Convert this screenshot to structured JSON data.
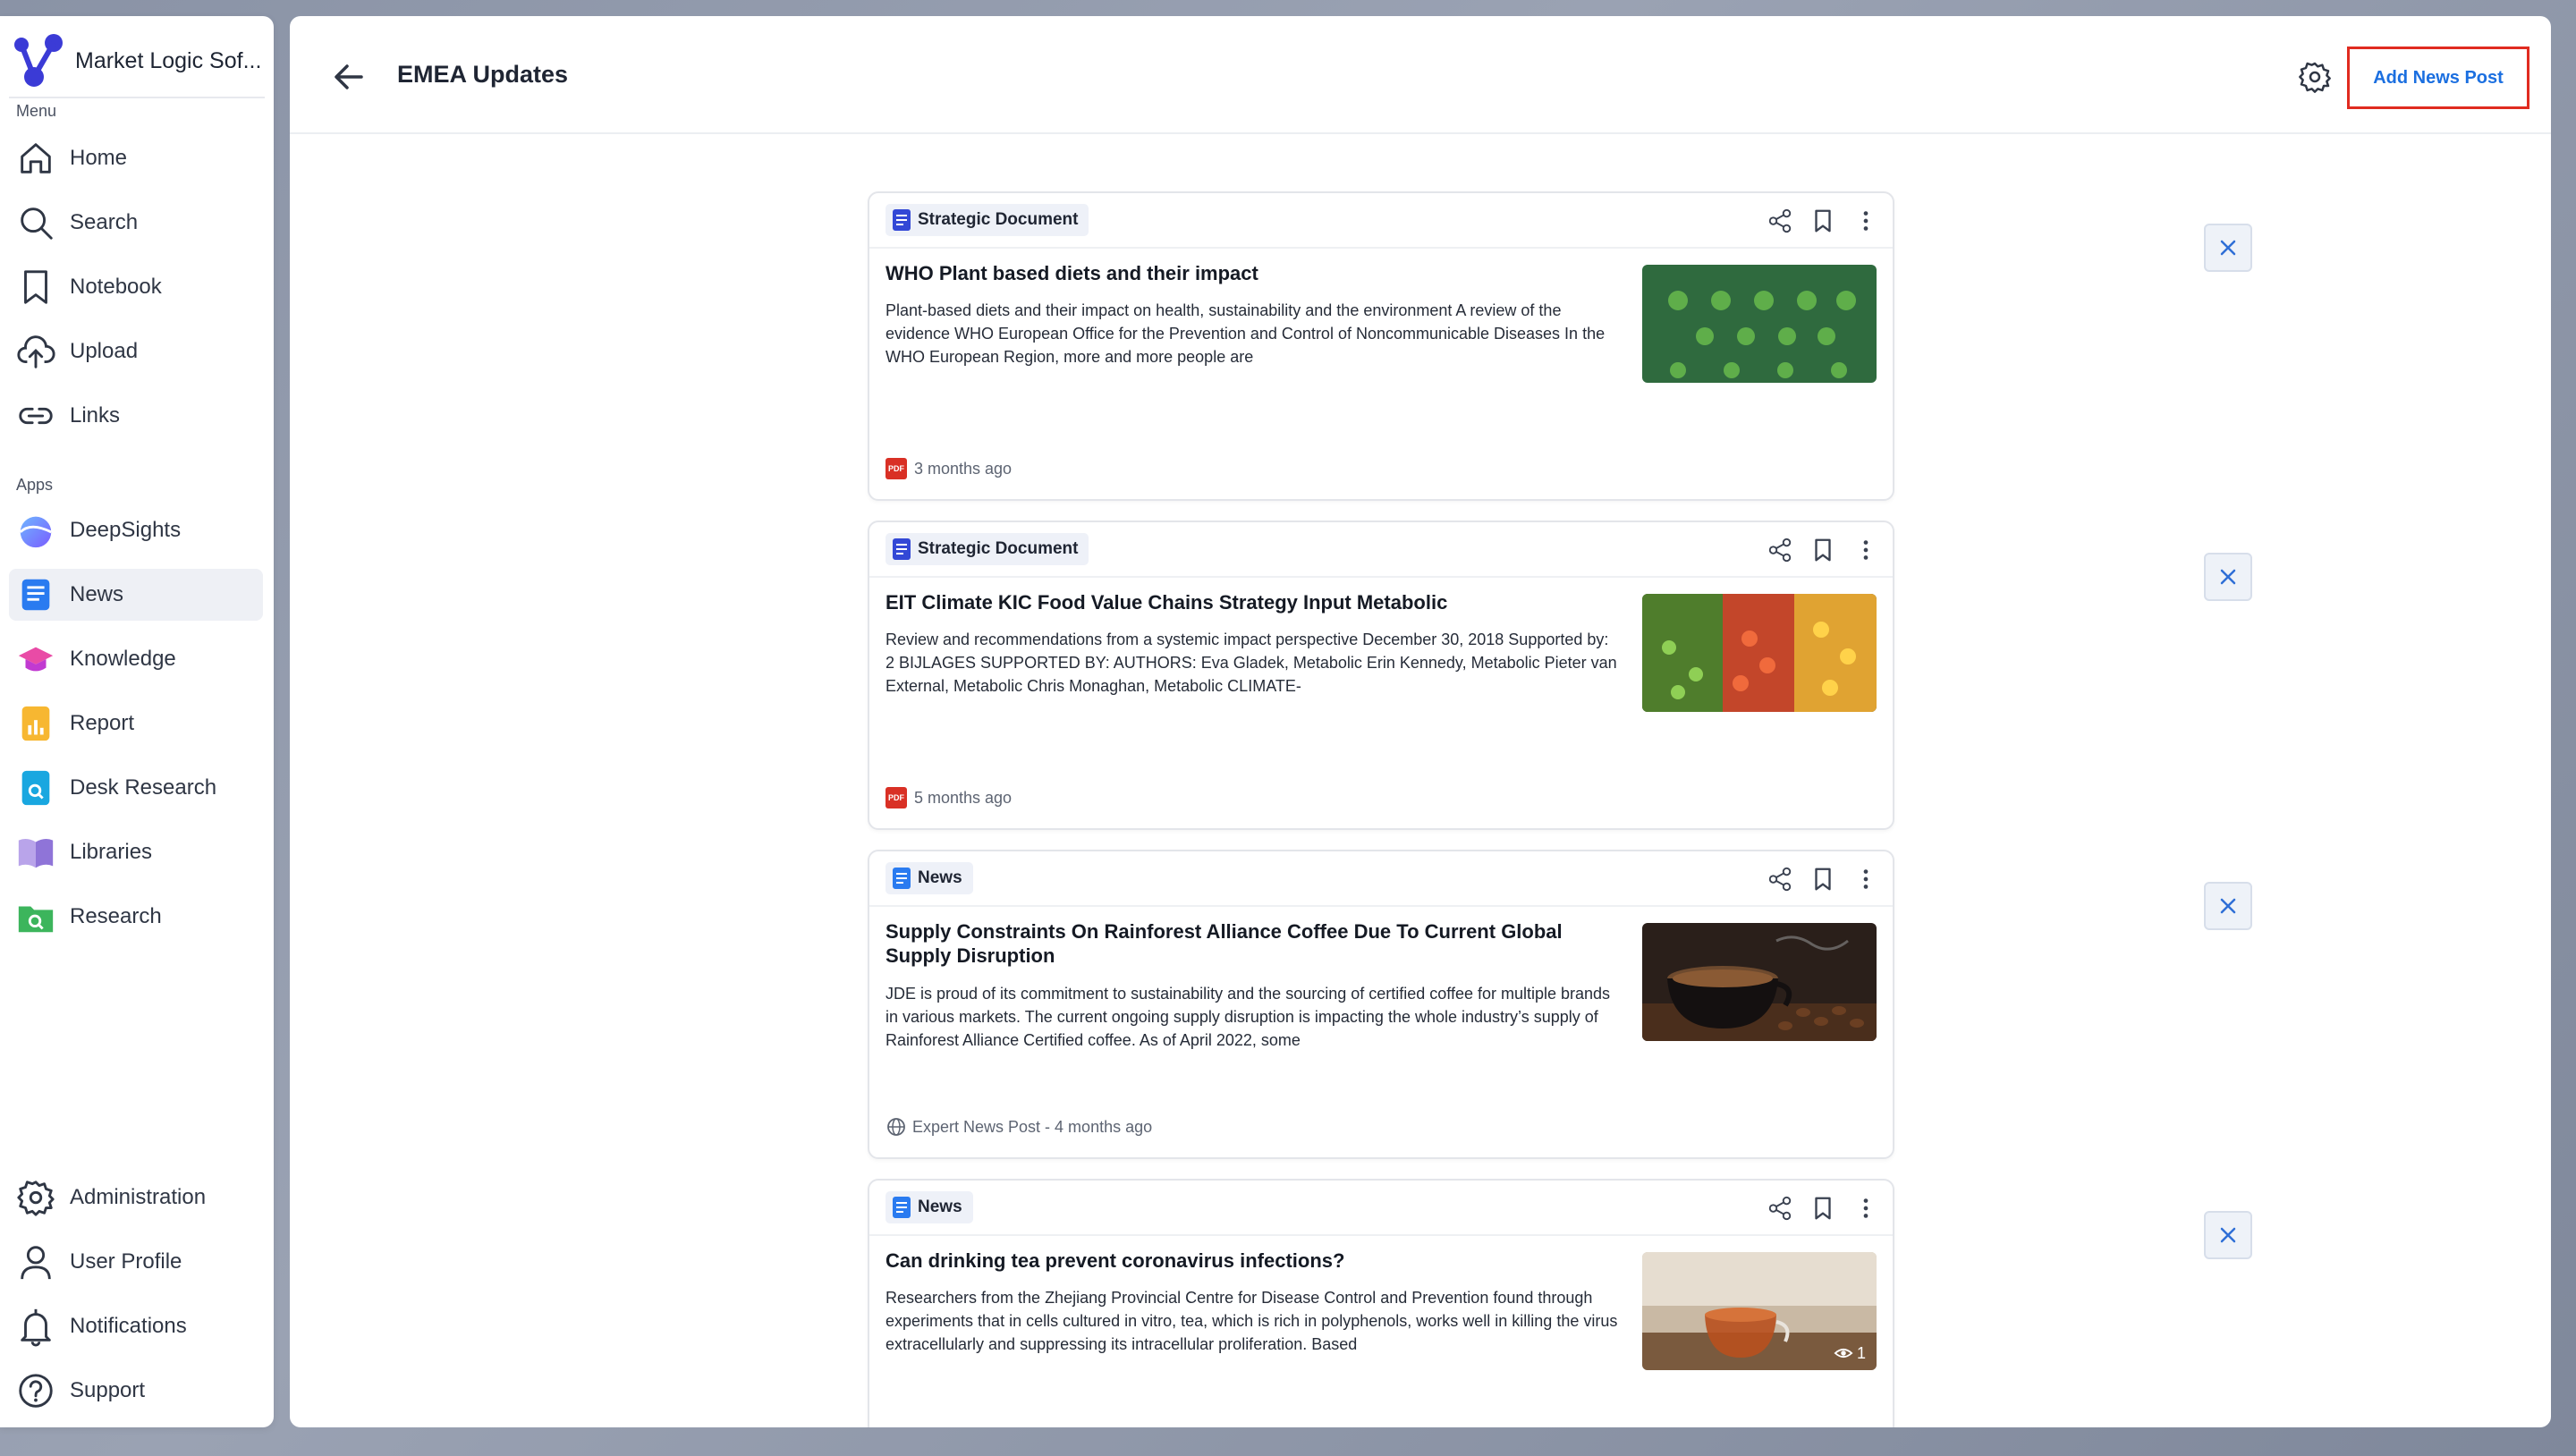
{
  "brand": {
    "name": "Market Logic Sof..."
  },
  "sidebar": {
    "menu_label": "Menu",
    "apps_label": "Apps",
    "menu_items": [
      {
        "label": "Home",
        "icon": "home-icon"
      },
      {
        "label": "Search",
        "icon": "search-icon"
      },
      {
        "label": "Notebook",
        "icon": "bookmark-icon"
      },
      {
        "label": "Upload",
        "icon": "cloud-upload-icon"
      },
      {
        "label": "Links",
        "icon": "link-icon"
      }
    ],
    "app_items": [
      {
        "label": "DeepSights",
        "icon": "deepsights-icon"
      },
      {
        "label": "News",
        "icon": "news-icon",
        "active": true
      },
      {
        "label": "Knowledge",
        "icon": "knowledge-icon"
      },
      {
        "label": "Report",
        "icon": "report-icon"
      },
      {
        "label": "Desk Research",
        "icon": "desk-research-icon"
      },
      {
        "label": "Libraries",
        "icon": "libraries-icon"
      },
      {
        "label": "Research",
        "icon": "research-icon"
      }
    ],
    "bottom_items": [
      {
        "label": "Administration",
        "icon": "gear-icon"
      },
      {
        "label": "User Profile",
        "icon": "user-icon"
      },
      {
        "label": "Notifications",
        "icon": "bell-icon"
      },
      {
        "label": "Support",
        "icon": "help-icon"
      }
    ]
  },
  "header": {
    "title": "EMEA Updates",
    "add_button": "Add News Post"
  },
  "cards": [
    {
      "tag": "Strategic Document",
      "title": "WHO Plant based diets and their impact",
      "body": "Plant-based diets and their impact on health, sustainability and the environment A review of the evidence WHO European Office for the Prevention and Control of Noncommunicable Diseases In the WHO European Region, more and more people are",
      "source": "",
      "time": "3 months ago",
      "foot_icon": "pdf-icon",
      "thumb": "vegetables-green"
    },
    {
      "tag": "Strategic Document",
      "title": "EIT Climate KIC Food Value Chains Strategy Input Metabolic",
      "body": "Review and recommendations from a systemic impact perspective December 30, 2018 Supported by: 2 BIJLAGES SUPPORTED BY: AUTHORS: Eva Gladek, Metabolic Erin Kennedy, Metabolic Pieter van External, Metabolic Chris Monaghan, Metabolic CLIMATE-",
      "source": "",
      "time": "5 months ago",
      "foot_icon": "pdf-icon",
      "thumb": "market-produce"
    },
    {
      "tag": "News",
      "title": "Supply Constraints On Rainforest Alliance Coffee Due To Current Global Supply Disruption",
      "body": "JDE is proud of its commitment to sustainability and the sourcing of certified coffee for multiple brands in various markets. The current ongoing supply disruption is impacting the whole industry’s supply of Rainforest Alliance Certified coffee. As of April 2022, some",
      "source": "Expert News Post - 4 months ago",
      "time": "",
      "foot_icon": "globe-icon",
      "thumb": "coffee-cup"
    },
    {
      "tag": "News",
      "title": "Can drinking tea prevent coronavirus infections?",
      "body": "Researchers from the Zhejiang Provincial Centre for Disease Control and Prevention found through experiments that in cells cultured in vitro, tea, which is rich in polyphenols, works well in killing the virus extracellularly and suppressing its intracellular proliferation. Based",
      "source": "",
      "time": "",
      "foot_icon": "",
      "thumb": "tea-cup",
      "views": "1"
    }
  ],
  "colors": {
    "accent": "#1b6fe0",
    "highlight_border": "#e02b20"
  }
}
